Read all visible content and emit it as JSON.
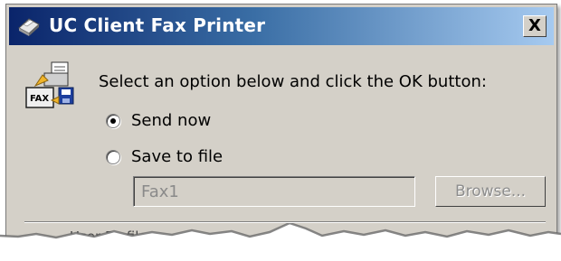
{
  "window": {
    "title": "UC Client Fax Printer",
    "close_label": "X"
  },
  "dialog": {
    "prompt": "Select an option below and click the OK button:",
    "options": [
      {
        "label": "Send now",
        "selected": true
      },
      {
        "label": "Save to file",
        "selected": false
      }
    ],
    "file_field": {
      "value": "Fax1",
      "enabled": false
    },
    "browse_label": "Browse..."
  },
  "torn_fragment": {
    "text": "User Profile"
  },
  "icons": {
    "title": "printer-icon",
    "dialog": "fax-machine-icon",
    "close": "close-icon"
  },
  "colors": {
    "titlebar_start": "#0a246a",
    "titlebar_end": "#a6caf0",
    "dialog_bg": "#d4d0c8"
  }
}
